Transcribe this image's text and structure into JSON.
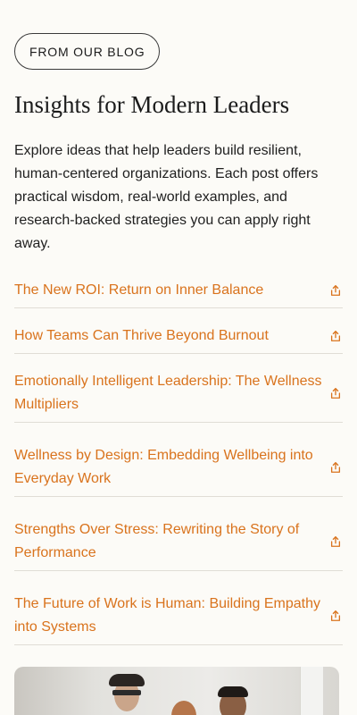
{
  "badge": "FROM OUR BLOG",
  "title": "Insights for Modern Leaders",
  "intro": "Explore ideas that help leaders build resilient, human-centered organizations. Each post offers practical wisdom, real-world examples, and research-backed strategies you can apply right away.",
  "posts": [
    {
      "title": "The New ROI: Return on Inner Balance"
    },
    {
      "title": "How Teams Can Thrive Beyond Burnout"
    },
    {
      "title": "Emotionally Intelligent Leadership: The Wellness Multipliers"
    },
    {
      "title": "Wellness by Design: Embedding Wellbeing into Everyday Work"
    },
    {
      "title": "Strengths Over Stress: Rewriting the Story of Performance"
    },
    {
      "title": "The Future of Work is Human: Building Empathy into Systems"
    }
  ],
  "icons": {
    "share": "share-icon"
  },
  "colors": {
    "accent": "#d9731d",
    "background": "#fcfbf7",
    "text": "#1d1d1d"
  }
}
